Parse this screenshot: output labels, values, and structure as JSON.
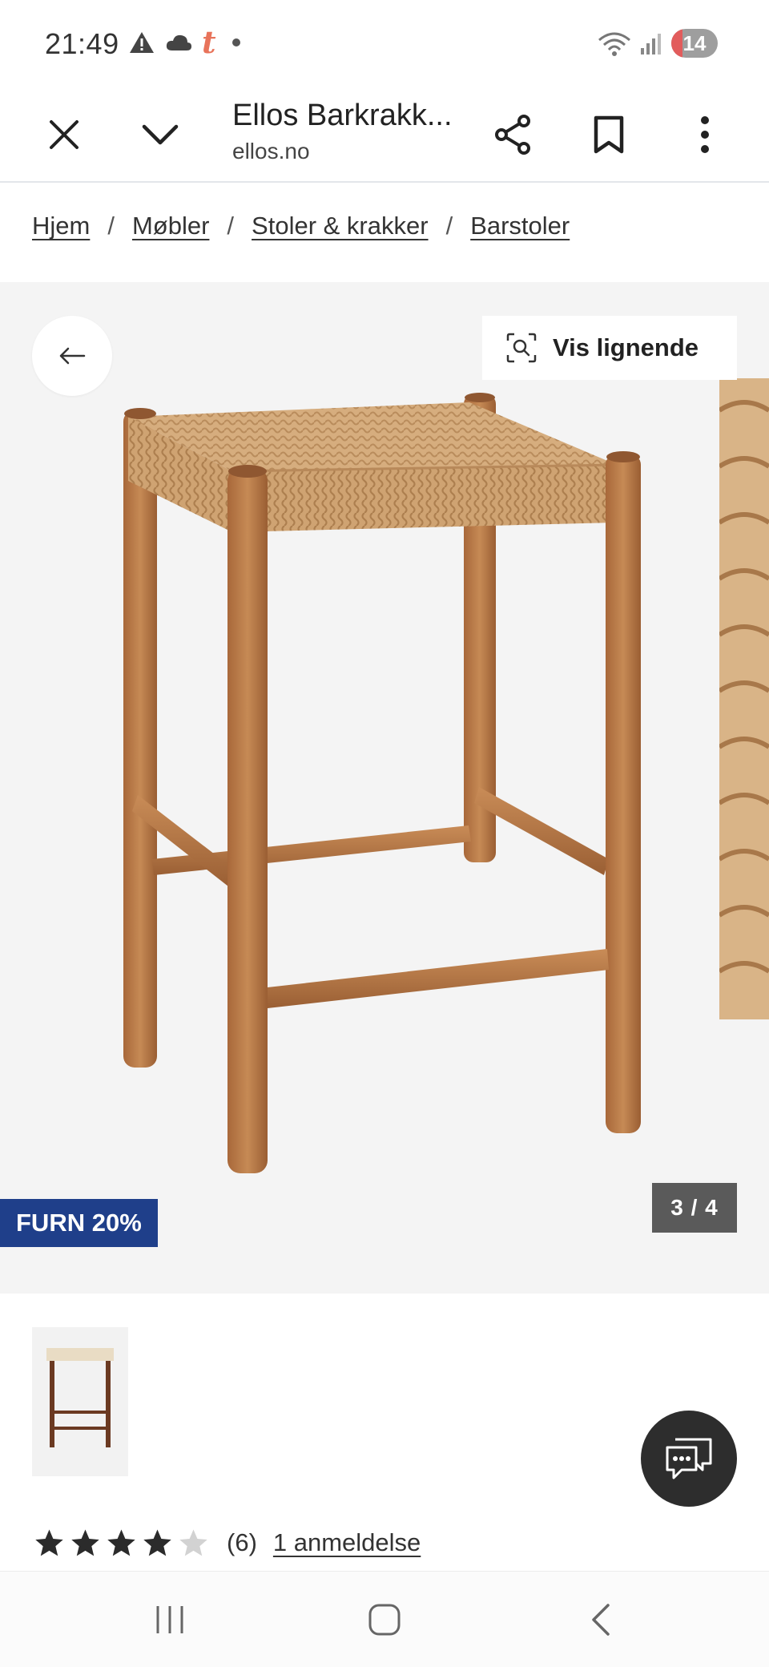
{
  "status_bar": {
    "time": "21:49",
    "battery": "14",
    "icons": [
      "warning-icon",
      "cloud-icon",
      "tumblr-icon",
      "dot-icon",
      "wifi-icon",
      "signal-icon",
      "battery-icon"
    ]
  },
  "browser": {
    "title": "Ellos Barkrakk...",
    "url": "ellos.no",
    "icons": [
      "close-icon",
      "chevron-down-icon",
      "share-icon",
      "bookmark-icon",
      "more-vert-icon"
    ]
  },
  "breadcrumb": {
    "items": [
      "Hjem",
      "Møbler",
      "Stoler & krakker",
      "Barstoler"
    ],
    "separator": "/"
  },
  "gallery": {
    "similar_label": "Vis lignende",
    "promo": "FURN 20%",
    "counter": "3 / 4",
    "colors": {
      "promo_bg": "#1f3f8a",
      "counter_bg": "#5a5a5a",
      "image_bg": "#f4f4f4"
    }
  },
  "rating": {
    "value": 4,
    "max": 5,
    "count": "(6)",
    "reviews_link": "1 anmeldelse"
  },
  "nav": {
    "icons": [
      "recents-icon",
      "home-icon",
      "back-icon"
    ]
  }
}
